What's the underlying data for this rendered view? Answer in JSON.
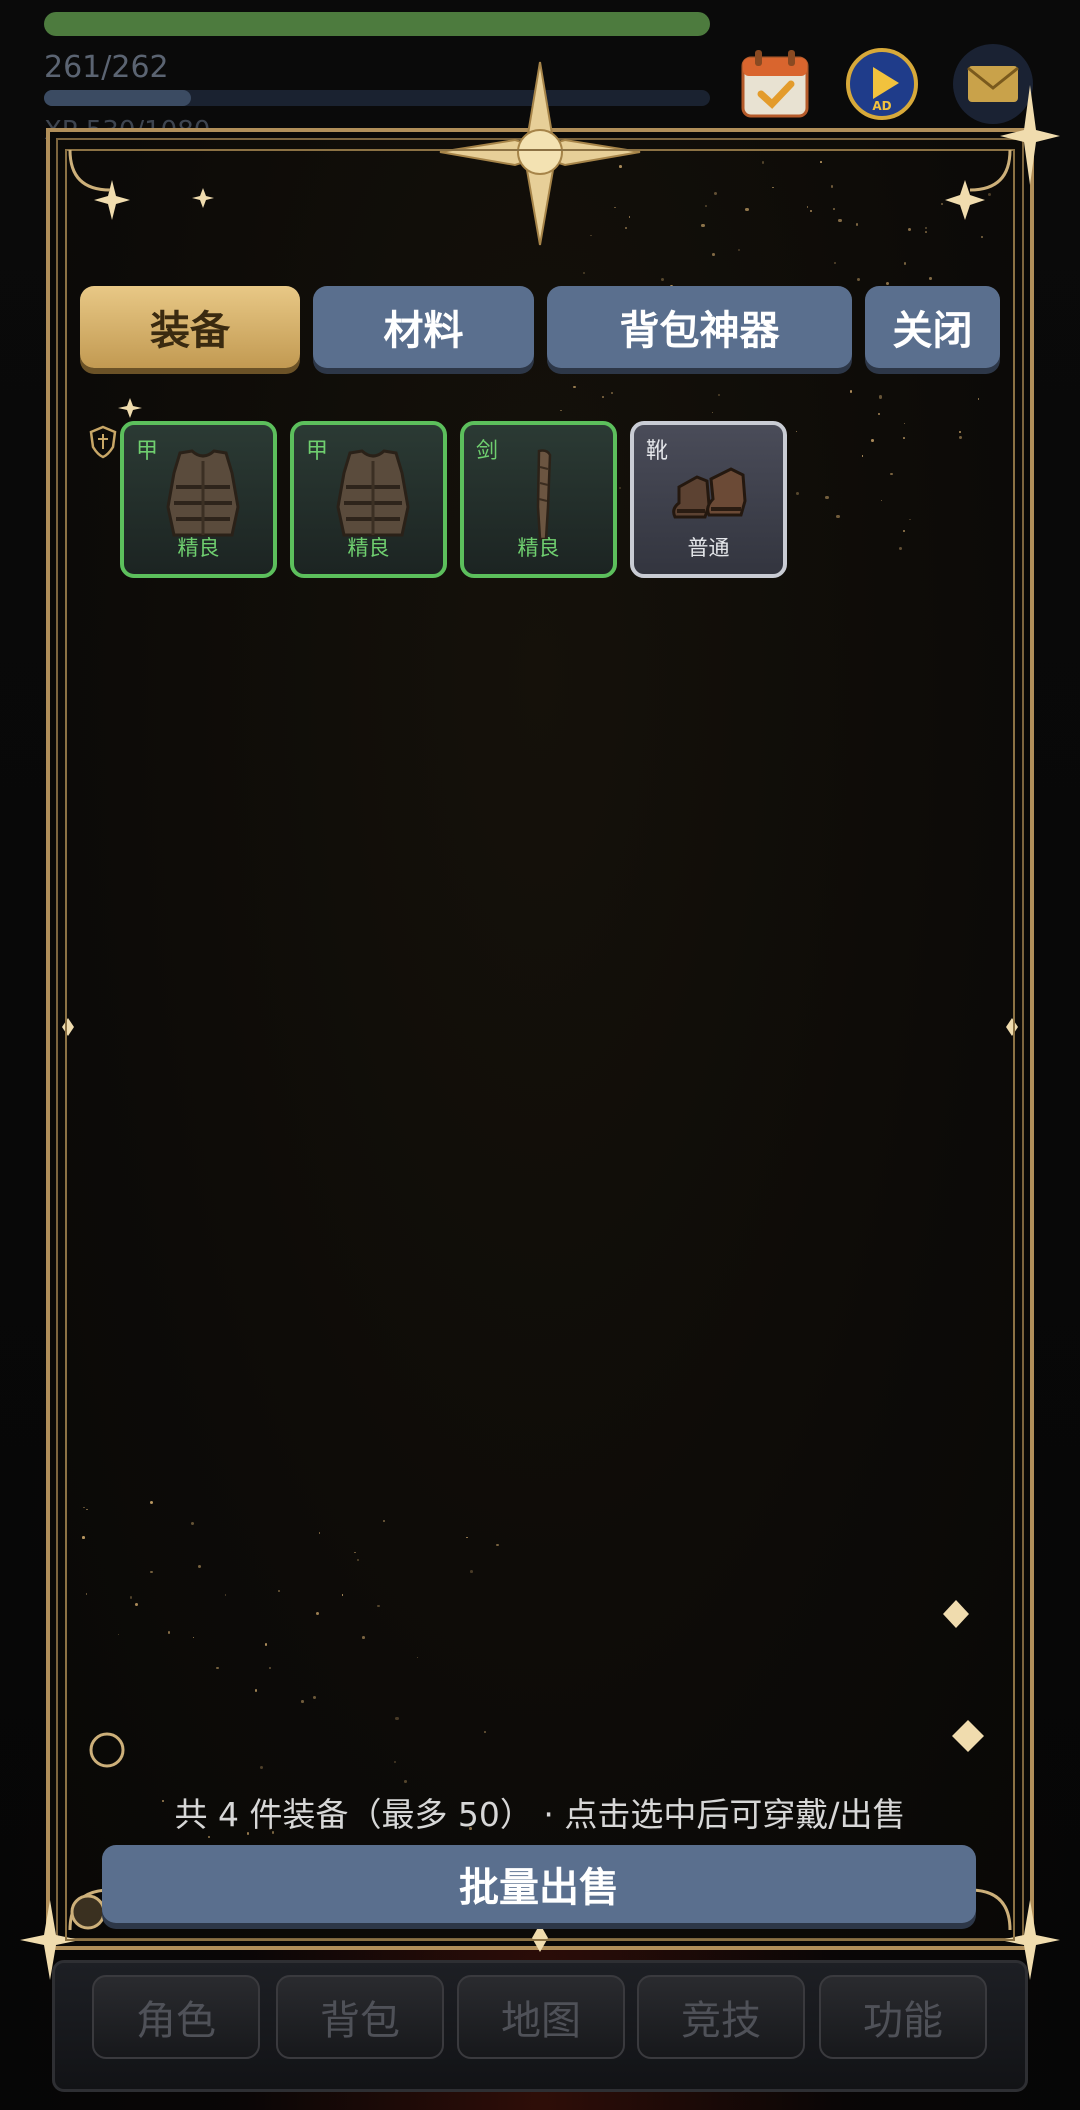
{
  "hud": {
    "hp_text": "261/262",
    "hp_fraction": 0.996,
    "xp_text": "XP 530/1080",
    "xp_fraction": 0.22,
    "icons": [
      "calendar-check-icon",
      "video-ad-icon",
      "mail-icon"
    ],
    "ad_badge": "AD"
  },
  "tabs": [
    {
      "label": "装备",
      "active": true
    },
    {
      "label": "材料",
      "active": false
    },
    {
      "label": "背包神器",
      "active": false
    },
    {
      "label": "关闭",
      "active": false
    }
  ],
  "items": [
    {
      "slot": "甲",
      "quality": "精良",
      "icon": "chest-armor-icon",
      "rarity_color": "#5cbf5c"
    },
    {
      "slot": "甲",
      "quality": "精良",
      "icon": "chest-armor-icon",
      "rarity_color": "#5cbf5c"
    },
    {
      "slot": "剑",
      "quality": "精良",
      "icon": "wooden-club-icon",
      "rarity_color": "#5cbf5c"
    },
    {
      "slot": "靴",
      "quality": "普通",
      "icon": "boots-icon",
      "rarity_color": "#c9ccd4"
    }
  ],
  "footer": {
    "info": "共 4 件装备（最多 50） · 点击选中后可穿戴/出售",
    "sell_button": "批量出售"
  },
  "nav": [
    "角色",
    "背包",
    "地图",
    "竞技",
    "功能"
  ],
  "colors": {
    "accent_gold": "#c29a52",
    "button_blue": "#5a6f8e",
    "hp_green": "#4d7b3e",
    "frame_gold": "#b18f5a"
  }
}
